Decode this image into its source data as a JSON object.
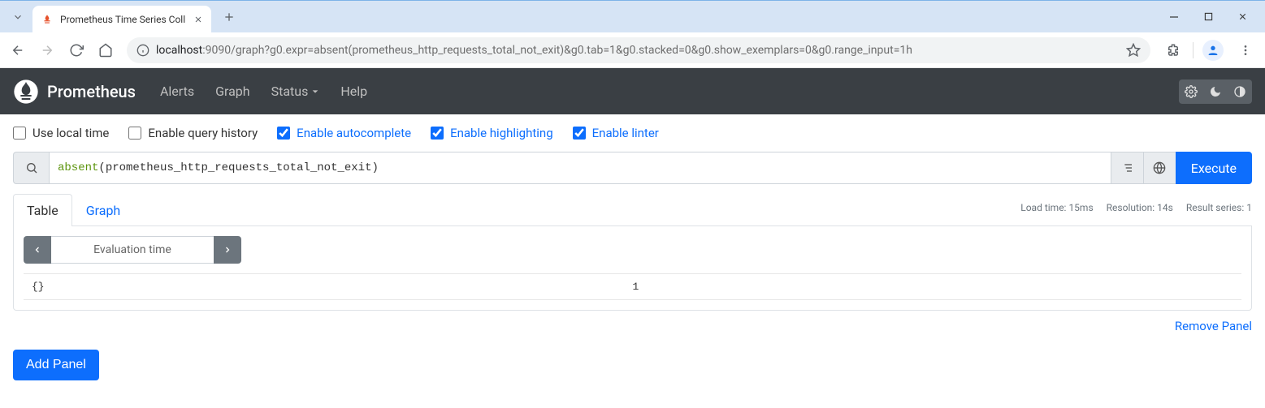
{
  "browser": {
    "tab_title": "Prometheus Time Series Coll",
    "url_host": "localhost",
    "url_rest": ":9090/graph?g0.expr=absent(prometheus_http_requests_total_not_exit)&g0.tab=1&g0.stacked=0&g0.show_exemplars=0&g0.range_input=1h"
  },
  "nav": {
    "brand": "Prometheus",
    "alerts": "Alerts",
    "graph": "Graph",
    "status": "Status",
    "help": "Help"
  },
  "options": {
    "local_time": "Use local time",
    "query_history": "Enable query history",
    "autocomplete": "Enable autocomplete",
    "highlighting": "Enable highlighting",
    "linter": "Enable linter"
  },
  "query": {
    "fn": "absent",
    "metric": "prometheus_http_requests_total_not_exit",
    "execute": "Execute"
  },
  "tabs": {
    "table": "Table",
    "graph": "Graph"
  },
  "meta": {
    "load": "Load time: 15ms",
    "resolution": "Resolution: 14s",
    "series": "Result series: 1"
  },
  "eval_placeholder": "Evaluation time",
  "result": {
    "key": "{}",
    "value": "1"
  },
  "remove_panel": "Remove Panel",
  "add_panel": "Add Panel"
}
